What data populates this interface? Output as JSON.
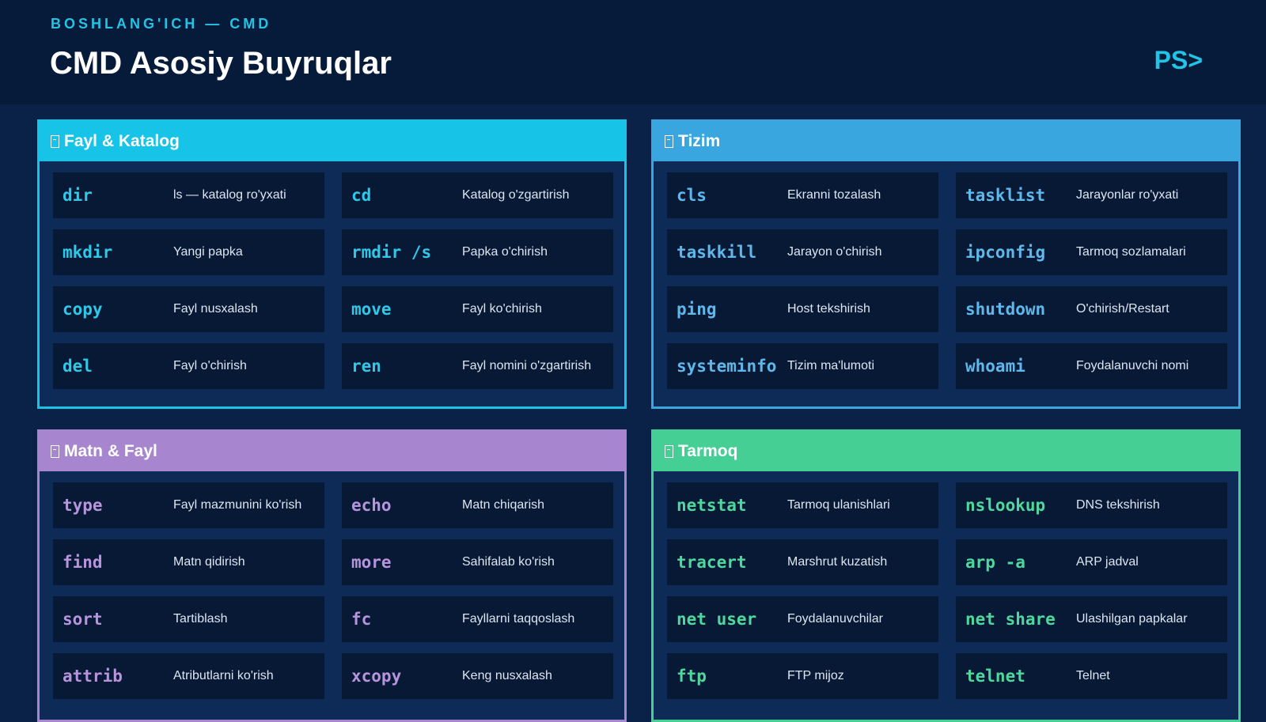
{
  "header": {
    "eyebrow": "BOSHLANG'ICH — CMD",
    "title": "CMD Asosiy Buyruqlar",
    "logo": "PS>"
  },
  "colors": {
    "background": "#0b2248",
    "header_bg": "#061a3a",
    "accent": "#22c4e6",
    "fayl_katalog": "#17c4e8",
    "tizim": "#3aa6e0",
    "matn_fayl": "#a886cf",
    "tarmoq": "#45cf95"
  },
  "panels": [
    {
      "title": "Fayl & Katalog",
      "icon": "folder-icon",
      "rows": [
        {
          "cmd": "dir",
          "desc": "ls — katalog ro'yxati"
        },
        {
          "cmd": "cd",
          "desc": "Katalog o'zgartirish"
        },
        {
          "cmd": "mkdir",
          "desc": "Yangi papka"
        },
        {
          "cmd": "rmdir /s",
          "desc": "Papka o'chirish"
        },
        {
          "cmd": "copy",
          "desc": "Fayl nusxalash"
        },
        {
          "cmd": "move",
          "desc": "Fayl ko'chirish"
        },
        {
          "cmd": "del",
          "desc": "Fayl o'chirish"
        },
        {
          "cmd": "ren",
          "desc": "Fayl nomini o'zgartirish"
        }
      ]
    },
    {
      "title": "Tizim",
      "icon": "computer-icon",
      "rows": [
        {
          "cmd": "cls",
          "desc": "Ekranni tozalash"
        },
        {
          "cmd": "tasklist",
          "desc": "Jarayonlar ro'yxati"
        },
        {
          "cmd": "taskkill",
          "desc": "Jarayon o'chirish"
        },
        {
          "cmd": "ipconfig",
          "desc": "Tarmoq sozlamalari"
        },
        {
          "cmd": "ping",
          "desc": "Host tekshirish"
        },
        {
          "cmd": "shutdown",
          "desc": "O'chirish/Restart"
        },
        {
          "cmd": "systeminfo",
          "desc": "Tizim ma'lumoti"
        },
        {
          "cmd": "whoami",
          "desc": "Foydalanuvchi nomi"
        }
      ]
    },
    {
      "title": "Matn & Fayl",
      "icon": "document-icon",
      "rows": [
        {
          "cmd": "type",
          "desc": "Fayl mazmunini ko'rish"
        },
        {
          "cmd": "echo",
          "desc": "Matn chiqarish"
        },
        {
          "cmd": "find",
          "desc": "Matn qidirish"
        },
        {
          "cmd": "more",
          "desc": "Sahifalab ko'rish"
        },
        {
          "cmd": "sort",
          "desc": "Tartiblash"
        },
        {
          "cmd": "fc",
          "desc": "Fayllarni taqqoslash"
        },
        {
          "cmd": "attrib",
          "desc": "Atributlarni ko'rish"
        },
        {
          "cmd": "xcopy",
          "desc": "Keng nusxalash"
        }
      ]
    },
    {
      "title": "Tarmoq",
      "icon": "globe-icon",
      "rows": [
        {
          "cmd": "netstat",
          "desc": "Tarmoq ulanishlari"
        },
        {
          "cmd": "nslookup",
          "desc": "DNS tekshirish"
        },
        {
          "cmd": "tracert",
          "desc": "Marshrut kuzatish"
        },
        {
          "cmd": "arp -a",
          "desc": "ARP jadval"
        },
        {
          "cmd": "net user",
          "desc": "Foydalanuvchilar"
        },
        {
          "cmd": "net share",
          "desc": "Ulashilgan papkalar"
        },
        {
          "cmd": "ftp",
          "desc": "FTP mijoz"
        },
        {
          "cmd": "telnet",
          "desc": "Telnet"
        }
      ]
    }
  ]
}
